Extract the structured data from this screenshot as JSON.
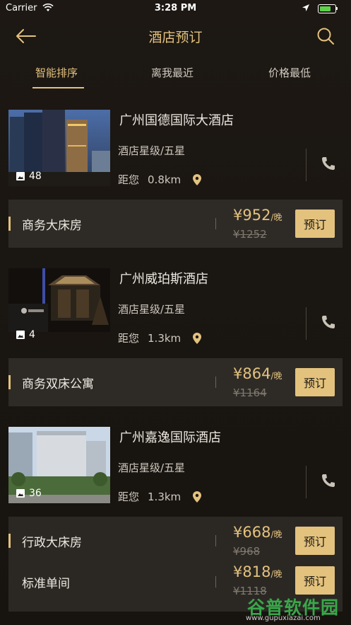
{
  "status_bar": {
    "carrier": "Carrier",
    "time": "3:28 PM"
  },
  "nav": {
    "title": "酒店预订"
  },
  "tabs": [
    {
      "label": "智能排序",
      "active": true
    },
    {
      "label": "离我最近",
      "active": false
    },
    {
      "label": "价格最低",
      "active": false
    }
  ],
  "hotels": [
    {
      "name": "广州国德国际大酒店",
      "star": "酒店星级/五星",
      "distance_label": "距您",
      "distance": "0.8km",
      "photo_count": "48",
      "rooms": [
        {
          "name": "商务大床房",
          "price": "¥952",
          "unit": "/晚",
          "original": "¥1252",
          "book": "预订"
        }
      ]
    },
    {
      "name": "广州威珀斯酒店",
      "star": "酒店星级/五星",
      "distance_label": "距您",
      "distance": "1.3km",
      "photo_count": "4",
      "rooms": [
        {
          "name": "商务双床公寓",
          "price": "¥864",
          "unit": "/晚",
          "original": "¥1164",
          "book": "预订"
        }
      ]
    },
    {
      "name": "广州嘉逸国际酒店",
      "star": "酒店星级/五星",
      "distance_label": "距您",
      "distance": "1.3km",
      "photo_count": "36",
      "rooms": [
        {
          "name": "行政大床房",
          "price": "¥668",
          "unit": "/晚",
          "original": "¥968",
          "book": "预订"
        },
        {
          "name": "标准单间",
          "price": "¥818",
          "unit": "/晚",
          "original": "¥1118",
          "book": "预订"
        }
      ]
    }
  ],
  "watermark": {
    "text": "谷普软件园",
    "url": "www.gupuxiazai.com"
  },
  "colors": {
    "accent": "#e3c27e",
    "background": "#1a1612",
    "room_bar": "#2e2b27"
  }
}
